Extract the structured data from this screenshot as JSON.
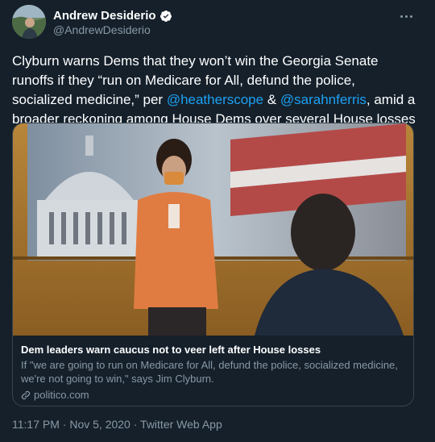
{
  "user": {
    "display_name": "Andrew Desiderio",
    "handle": "@AndrewDesiderio"
  },
  "tweet": {
    "text_1": "Clyburn warns Dems that they won’t win the Georgia Senate runoffs if they “run on Medicare for All, defund the police, socialized medicine,” per ",
    "mention_1": "@heatherscope",
    "text_2": " & ",
    "mention_2": "@sarahnferris",
    "text_3": ", amid a broader reckoning among House Dems over several House losses this week."
  },
  "card": {
    "title": "Dem leaders warn caucus not to veer left after House losses",
    "description": "If \"we are going to run on Medicare for All, defund the police, socialized medicine, we're not going to win,\" says Jim Clyburn.",
    "domain": "politico.com"
  },
  "meta": {
    "time": "11:17 PM",
    "separator_1": " · ",
    "date": "Nov 5, 2020",
    "separator_2": " · ",
    "source": "Twitter Web App"
  },
  "colors": {
    "background": "#15202b",
    "link": "#1da1f2",
    "secondary": "#8899a6",
    "border": "#38444d"
  },
  "icons": {
    "verified": "verified-badge-icon",
    "more": "more-options-icon",
    "link": "link-icon"
  }
}
